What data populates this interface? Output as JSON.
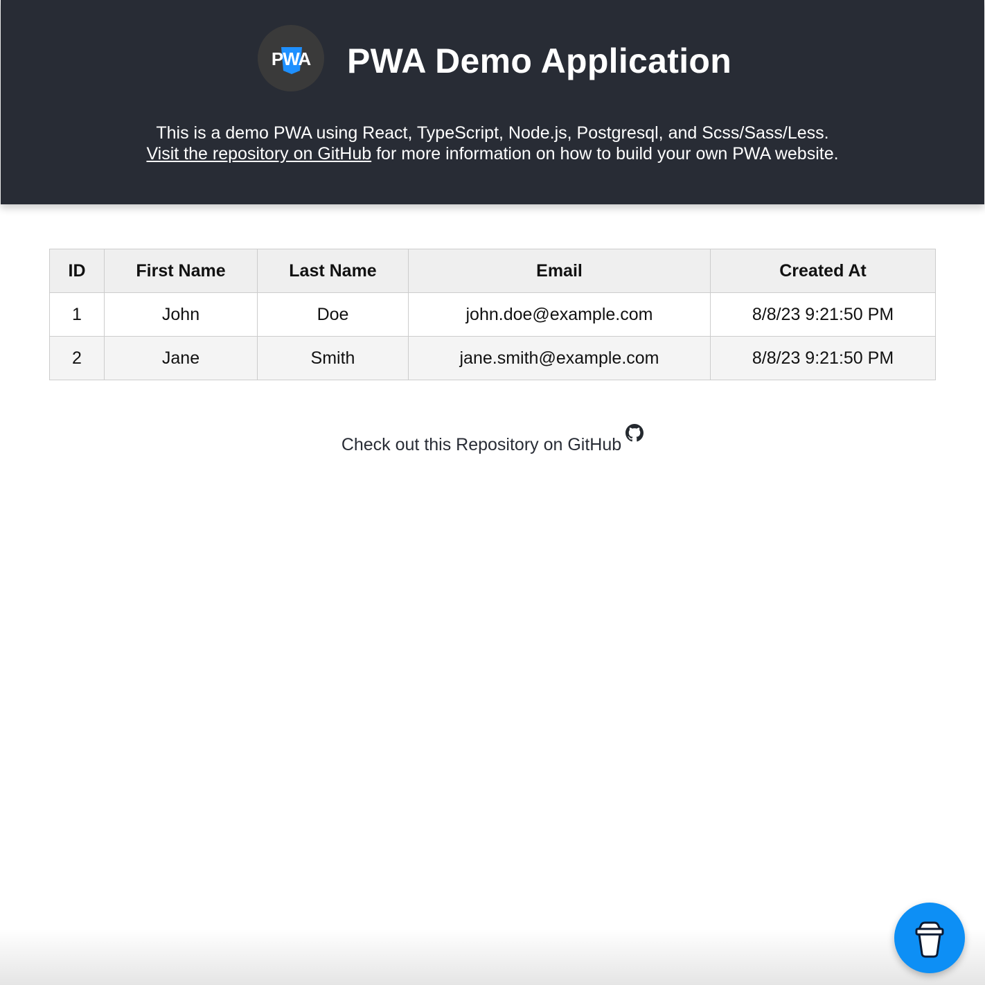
{
  "header": {
    "logo_text": "PWA",
    "title": "PWA Demo Application",
    "intro_line1": "This is a demo PWA using React, TypeScript, Node.js, Postgresql, and Scss/Sass/Less.",
    "intro_link": "Visit the repository on GitHub",
    "intro_line2_rest": " for more information on how to build your own PWA website.",
    "background_color": "#282c35"
  },
  "table": {
    "columns": [
      "ID",
      "First Name",
      "Last Name",
      "Email",
      "Created At"
    ],
    "rows": [
      [
        "1",
        "John",
        "Doe",
        "john.doe@example.com",
        "8/8/23 9:21:50 PM"
      ],
      [
        "2",
        "Jane",
        "Smith",
        "jane.smith@example.com",
        "8/8/23 9:21:50 PM"
      ]
    ]
  },
  "footer": {
    "repo_link": "Check out this Repository on GitHub",
    "repo_icon": "github-icon"
  },
  "coffee_button": {
    "icon": "coffee-cup-icon",
    "color": "#0d8ff5"
  }
}
